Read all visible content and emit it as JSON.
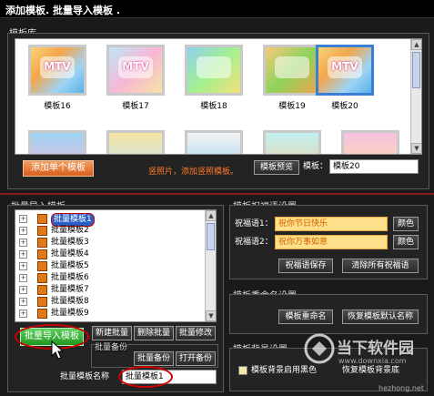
{
  "window": {
    "title": "添加模板. 批量导入模板 ."
  },
  "library": {
    "label": "模板库",
    "thumbs": [
      {
        "label": "模板16",
        "text": "MTV",
        "selected": false
      },
      {
        "label": "模板17",
        "text": "MTV",
        "selected": false
      },
      {
        "label": "模板18",
        "text": "",
        "selected": false
      },
      {
        "label": "模板19",
        "text": "",
        "selected": false
      },
      {
        "label": "模板20",
        "text": "MTV",
        "selected": true
      }
    ],
    "add_single_button": "添加单个模板",
    "hint": "竖照片，添加竖照模板。",
    "preview_button": "模板预览",
    "template_label": "模板：",
    "template_value": "模板20"
  },
  "batch": {
    "label": "批量导入模板",
    "tree_items": [
      "批量模板1",
      "批量模板2",
      "批量模板3",
      "批量模板4",
      "批量模板5",
      "批量模板6",
      "批量模板7",
      "批量模板8",
      "批量模板9"
    ],
    "import_button": "批量导入模板",
    "new_button": "新建批量",
    "delete_button": "删除批量",
    "modify_button": "批量修改",
    "backup_label": "批量备份",
    "backup_button": "批量备份",
    "open_backup_button": "打开备份",
    "name_label": "批量模板名称",
    "name_value": "批量模板1"
  },
  "greeting": {
    "label": "模板祝福语设置",
    "line1_label": "祝福语1：",
    "line1_value": "祝你节日快乐",
    "line2_label": "祝福语2：",
    "line2_value": "祝你万事如意",
    "color_button": "颜色",
    "save_button": "祝福语保存",
    "clear_button": "清除所有祝福语"
  },
  "rename": {
    "label": "模板重命名设置",
    "rename_button": "模板重命名",
    "restore_button": "恢复模板默认名称"
  },
  "background": {
    "label": "模板背景设置",
    "checkbox_text": "模板背景启用黑色",
    "restore_text": "恢复模板背景底"
  },
  "watermark": {
    "text": "当下软件园",
    "url": "www.downxia.com",
    "site": "hezhong.net"
  }
}
